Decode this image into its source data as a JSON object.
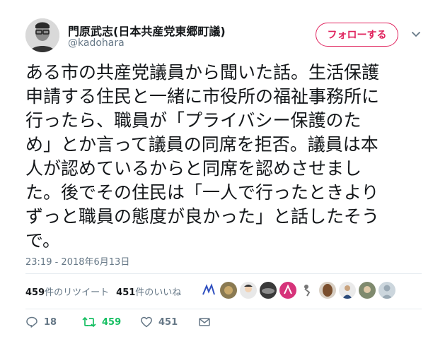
{
  "user": {
    "display_name": "門原武志(日本共産党東郷町議)",
    "handle": "@kadohara",
    "follow_label": "フォローする"
  },
  "tweet": {
    "lines": [
      "ある市の共産党議員から聞いた話。生活保護",
      "申請する住民と一緒に市役所の福祉事務所に",
      "行ったら、職員が「プライバシー保護のた",
      "め」とか言って議員の同席を拒否。議員は本",
      "人が認めているからと同席を認めさせまし",
      "た。後でその住民は「一人で行ったときより",
      "ずっと職員の態度が良かった」と話したそう",
      "で。"
    ],
    "timestamp": "23:19 - 2018年6月13日"
  },
  "stats": {
    "retweets_count": "459",
    "retweets_label": "件のリツイート",
    "likes_count": "451",
    "likes_label": "件のいいね"
  },
  "actions": {
    "reply_count": "18",
    "retweet_count": "459",
    "like_count": "451"
  },
  "colors": {
    "accent": "#e0245e",
    "retweet": "#17bf63",
    "muted": "#657786",
    "text": "#14171a",
    "divider": "#e6ecf0"
  },
  "icons": [
    "chevron-down-icon",
    "reply-icon",
    "retweet-icon",
    "heart-icon",
    "message-icon"
  ]
}
